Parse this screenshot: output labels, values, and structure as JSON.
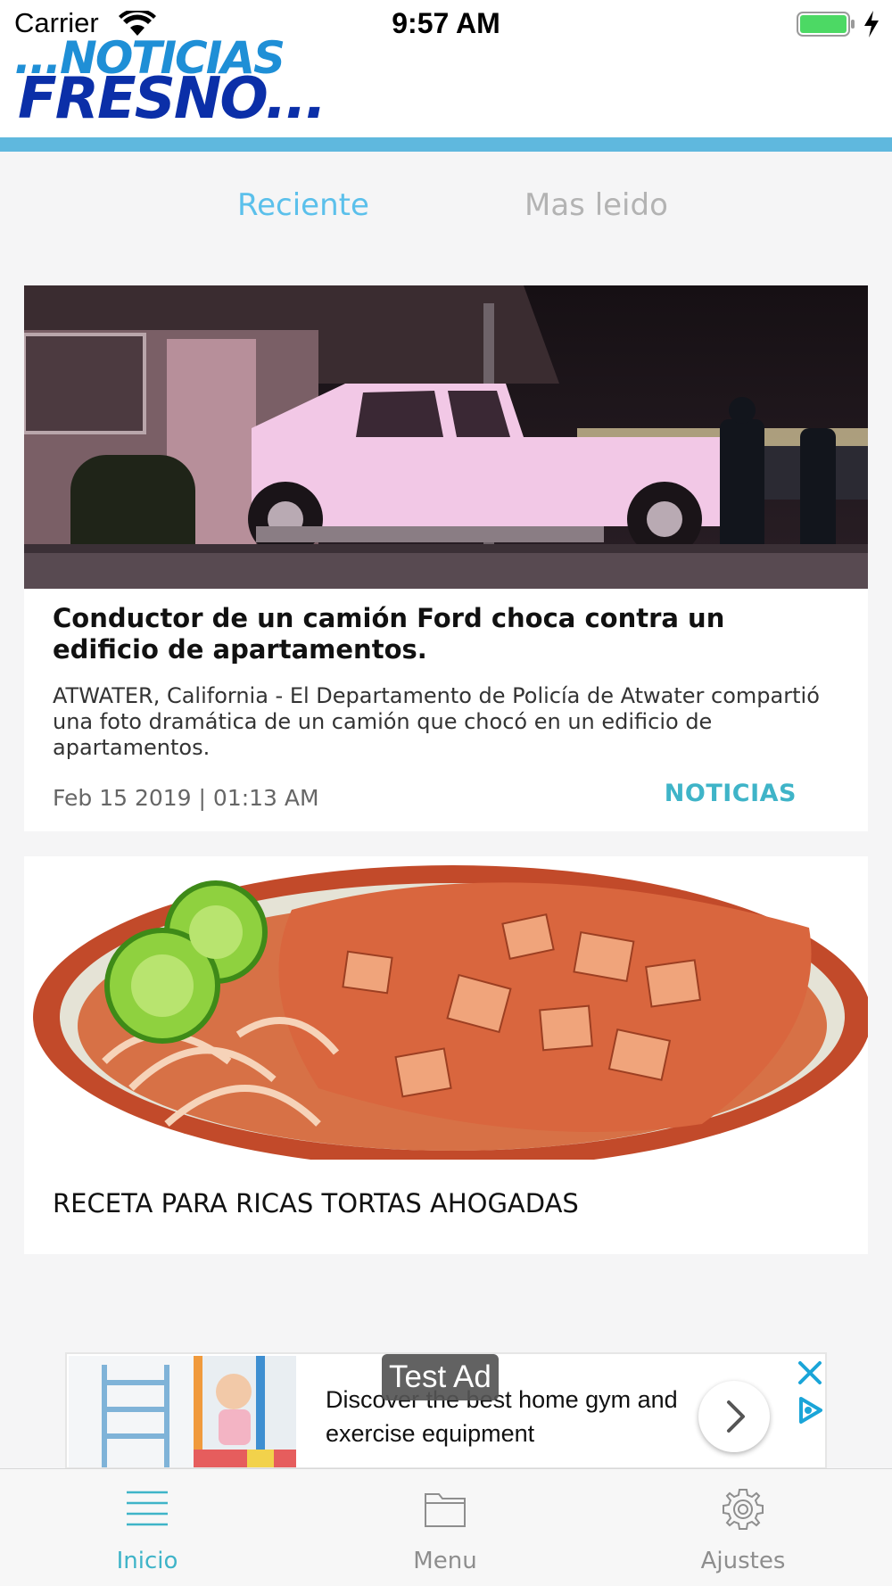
{
  "status_bar": {
    "carrier": "Carrier",
    "time": "9:57 AM"
  },
  "header": {
    "logo_line1": "...NOTICIAS",
    "logo_line2": "FRESNO...",
    "logo_colors": {
      "line1": "#1f8fd6",
      "line2": "#0b2fa8"
    },
    "accent_bar_color": "#5fb8de"
  },
  "tabs": [
    {
      "label": "Reciente",
      "active": true
    },
    {
      "label": "Mas leido",
      "active": false
    }
  ],
  "articles": [
    {
      "image": "white-pickup-truck-crashed-into-building-night-photo",
      "title": "Conductor de un camión Ford choca contra un edificio de apartamentos.",
      "summary": "ATWATER, California - El Departamento de Policía de Atwater compartió una foto dramática de un camión que chocó en un edificio de apartamentos.",
      "date": "Feb 15 2019 | 01:13 AM",
      "category": "NOTICIAS"
    },
    {
      "image": "tortas-ahogadas-plate-with-limes-photo",
      "title": "RECETA PARA RICAS TORTAS AHOGADAS"
    }
  ],
  "ad": {
    "badge": "Test Ad",
    "text": "Discover the best home gym and exercise equipment",
    "image": "child-on-home-gym-climbing-frame-photo",
    "arrow_icon": "chevron-right-icon",
    "close_icon": "close-icon",
    "adchoices_icon": "adchoices-icon"
  },
  "tabbar": [
    {
      "label": "Inicio",
      "icon": "hamburger-list-icon",
      "active": true
    },
    {
      "label": "Menu",
      "icon": "folder-icon",
      "active": false
    },
    {
      "label": "Ajustes",
      "icon": "gear-icon",
      "active": false
    }
  ],
  "colors": {
    "active_tab": "#5bc0eb",
    "inactive_tab": "#b3b3b3",
    "category": "#3fb4c8",
    "tabbar_active": "#3fb4c8"
  }
}
